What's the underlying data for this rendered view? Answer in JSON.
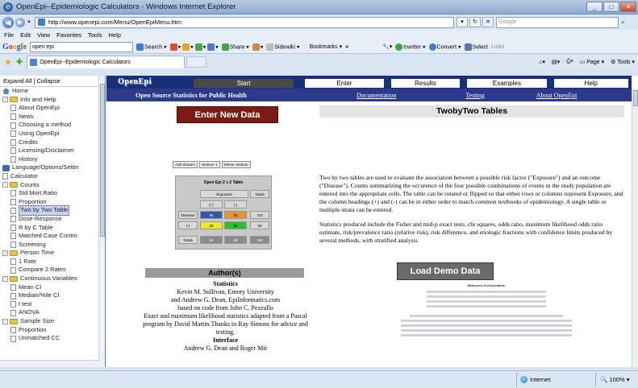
{
  "window": {
    "title": "OpenEpi--Epidemiologic Calculators - Windows Internet Explorer"
  },
  "address": {
    "url": "http://www.openepi.com/Menu/OpenEpiMenu.htm",
    "search_placeholder": "Google"
  },
  "menu": [
    "File",
    "Edit",
    "View",
    "Favorites",
    "Tools",
    "Help"
  ],
  "gtoolbar": {
    "search_value": "open epi",
    "items": [
      "Search",
      "Share",
      "Sidewiki",
      "Bookmarks",
      "»",
      "trvetter",
      "Convert",
      "Select",
      "Links"
    ]
  },
  "tab": {
    "label": "OpenEpi--Epidemiologic Calculators"
  },
  "commandbar": [
    "Page",
    "Tools"
  ],
  "sidebar": {
    "expand": "Expand All",
    "sep": "|",
    "collapse": "Collapse",
    "items": [
      {
        "label": "Home",
        "level": 0,
        "kind": "home"
      },
      {
        "label": "Info and Help",
        "level": 0,
        "kind": "folder",
        "exp": "-"
      },
      {
        "label": "About OpenEpi",
        "level": 1,
        "kind": "doc"
      },
      {
        "label": "News",
        "level": 1,
        "kind": "doc"
      },
      {
        "label": "Choosing a method",
        "level": 1,
        "kind": "doc"
      },
      {
        "label": "Using OpenEpi",
        "level": 1,
        "kind": "doc"
      },
      {
        "label": "Credits",
        "level": 1,
        "kind": "doc"
      },
      {
        "label": "Licensing/Disclaimer",
        "level": 1,
        "kind": "doc"
      },
      {
        "label": "History",
        "level": 1,
        "kind": "doc"
      },
      {
        "label": "Language/Options/Settin",
        "level": 0,
        "kind": "blue"
      },
      {
        "label": "Calculator",
        "level": 0,
        "kind": "doc"
      },
      {
        "label": "Counts",
        "level": 0,
        "kind": "folder",
        "exp": "-"
      },
      {
        "label": "Std.Mort.Ratio",
        "level": 1,
        "kind": "doc"
      },
      {
        "label": "Proportion",
        "level": 1,
        "kind": "doc"
      },
      {
        "label": "Two by Two Table",
        "level": 1,
        "kind": "doc",
        "selected": true
      },
      {
        "label": "Dose-Response",
        "level": 1,
        "kind": "doc"
      },
      {
        "label": "R by C Table",
        "level": 1,
        "kind": "doc"
      },
      {
        "label": "Matched Case Contro",
        "level": 1,
        "kind": "doc"
      },
      {
        "label": "Screening",
        "level": 1,
        "kind": "doc"
      },
      {
        "label": "Person Time",
        "level": 0,
        "kind": "folder",
        "exp": "-"
      },
      {
        "label": "1 Rate",
        "level": 1,
        "kind": "doc"
      },
      {
        "label": "Compare 2 Rates",
        "level": 1,
        "kind": "doc"
      },
      {
        "label": "Continuous Variables",
        "level": 0,
        "kind": "folder",
        "exp": "-"
      },
      {
        "label": "Mean CI",
        "level": 1,
        "kind": "doc"
      },
      {
        "label": "Median/%ile CI",
        "level": 1,
        "kind": "doc"
      },
      {
        "label": "t test",
        "level": 1,
        "kind": "doc"
      },
      {
        "label": "ANOVA",
        "level": 1,
        "kind": "doc"
      },
      {
        "label": "Sample Size",
        "level": 0,
        "kind": "folder",
        "exp": "-"
      },
      {
        "label": "Proportion",
        "level": 1,
        "kind": "doc"
      },
      {
        "label": "Unmatched CC",
        "level": 1,
        "kind": "doc"
      }
    ]
  },
  "site": {
    "logo": "OpenEpi",
    "tabs": [
      "Start",
      "Enter",
      "Results",
      "Examples",
      "Help"
    ],
    "active_tab": "Start",
    "brand": "Open Source Statistics for Public Health",
    "links": [
      "Documentation",
      "Testing",
      "About OpenEpi"
    ]
  },
  "main": {
    "enter_button": "Enter New Data",
    "mini": {
      "buttons": [
        "Add Stratum",
        "Stratum 1",
        "Delete Stratum"
      ],
      "title": "Open Epi 2 x 2 Table",
      "exposure": "'Exposure'",
      "totals": "Totals",
      "plus": "(+)",
      "minus": "(-)",
      "disease": "'Disease'",
      "totals_row": "Totals",
      "cells": {
        "a": "66",
        "b": "36",
        "c": "28",
        "d": "32",
        "r1": "102",
        "r2": "60",
        "c1": "94",
        "c2": "68",
        "n": "162"
      }
    },
    "author_head": "Author(s)",
    "author": {
      "statistics_head": "Statistics",
      "lines": [
        "Kevin M. Sullivan, Emory University",
        "and Andrew G. Dean, EpiInformatics.com",
        "based on code from John C. Pezzullo",
        "Exact and maximum likelihood statistics adapted from a Pascal program by David Martin.Thanks to Ray Simons for advice and testing."
      ],
      "interface_head": "Interface",
      "interface_line": "Andrew G. Dean and Roger Mir"
    },
    "title": "TwobyTwo Tables",
    "paragraphs": [
      "Two by two tables are used to evaluate the association between a possible risk factor (\"Exposure\") and an outcome (\"Disease\"). Counts summarizing the occurence of the four possible combinations of events in the study population are entered into the appropriate cells. The table can be rotated or flipped so that either rows or columns represent Exposure, and the column headings (+) and (-) can be in either order to match common textbooks of epidemiology. A single table or multiple strata can be entered.",
      "Statistics produced include the Fisher and mid-p exact tests, chi squares, odds ratio, maximum likelihood odds ratio estimate, risk/prevalence ratio (relative risk), risk difference, and etiologic fractions with confidence limits produced by several methods, with stratified analysis"
    ],
    "demo_button": "Load Demo Data",
    "demo_preview_title": "Measures of Association"
  },
  "status": {
    "zone": "Internet",
    "zoom": "100%"
  }
}
